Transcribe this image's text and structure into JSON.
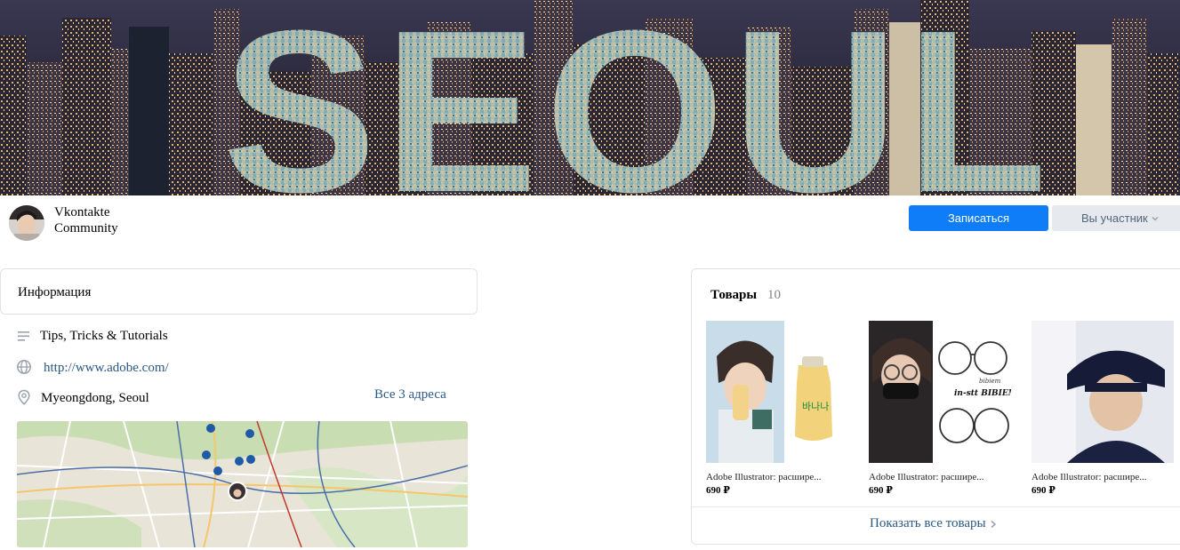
{
  "cover": {
    "text": "SEOUL"
  },
  "group": {
    "name_line1": "Vkontakte",
    "name_line2": "Community",
    "join_button": "Записаться",
    "member_button": "Вы участник"
  },
  "info": {
    "title": "Информация",
    "description": "Tips, Tricks & Tutorials",
    "website": "http://www.adobe.com/",
    "address": "Myeongdong, Seoul",
    "all_addresses": "Все 3 адреса"
  },
  "goods": {
    "title": "Товары",
    "count": "10",
    "items": [
      {
        "name": "Adobe Illustrator: расшире...",
        "price": "690 ₽"
      },
      {
        "name": "Adobe Illustrator: расшире...",
        "price": "690 ₽"
      },
      {
        "name": "Adobe Illustrator: расшире...",
        "price": "690 ₽"
      }
    ],
    "product2_caption_1": "bibiem",
    "product2_caption_2": "in-stt BIBIEM",
    "show_all": "Показать все товары"
  },
  "colors": {
    "accent": "#0f7df7",
    "link": "#2a5885",
    "secondary_button_bg": "#e6e9ee",
    "border": "#e1e3e6"
  },
  "icons": {
    "description": "lines-icon",
    "website": "globe-icon",
    "address": "location-pin-icon",
    "member_dropdown": "chevron-down-icon",
    "show_all": "chevron-right-icon"
  }
}
